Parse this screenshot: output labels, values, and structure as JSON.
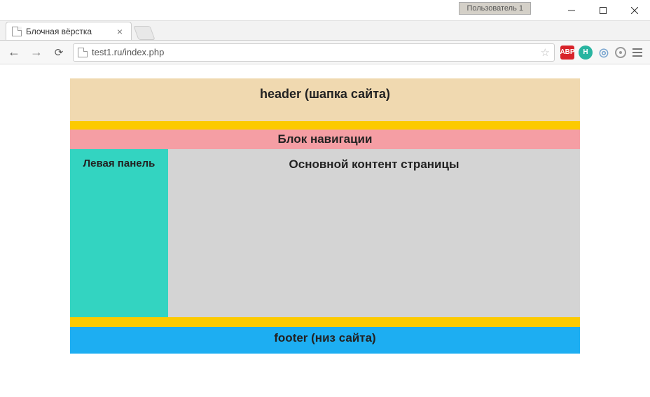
{
  "window": {
    "user_badge": "Пользователь 1"
  },
  "tab": {
    "title": "Блочная вёрстка"
  },
  "addressbar": {
    "url": "test1.ru/index.php"
  },
  "ext": {
    "abp": "ABP",
    "h": "H"
  },
  "page": {
    "header": "header (шапка сайта)",
    "nav": "Блок навигации",
    "left": "Левая панель",
    "main": "Основной контент страницы",
    "footer": "footer (низ сайта)"
  }
}
